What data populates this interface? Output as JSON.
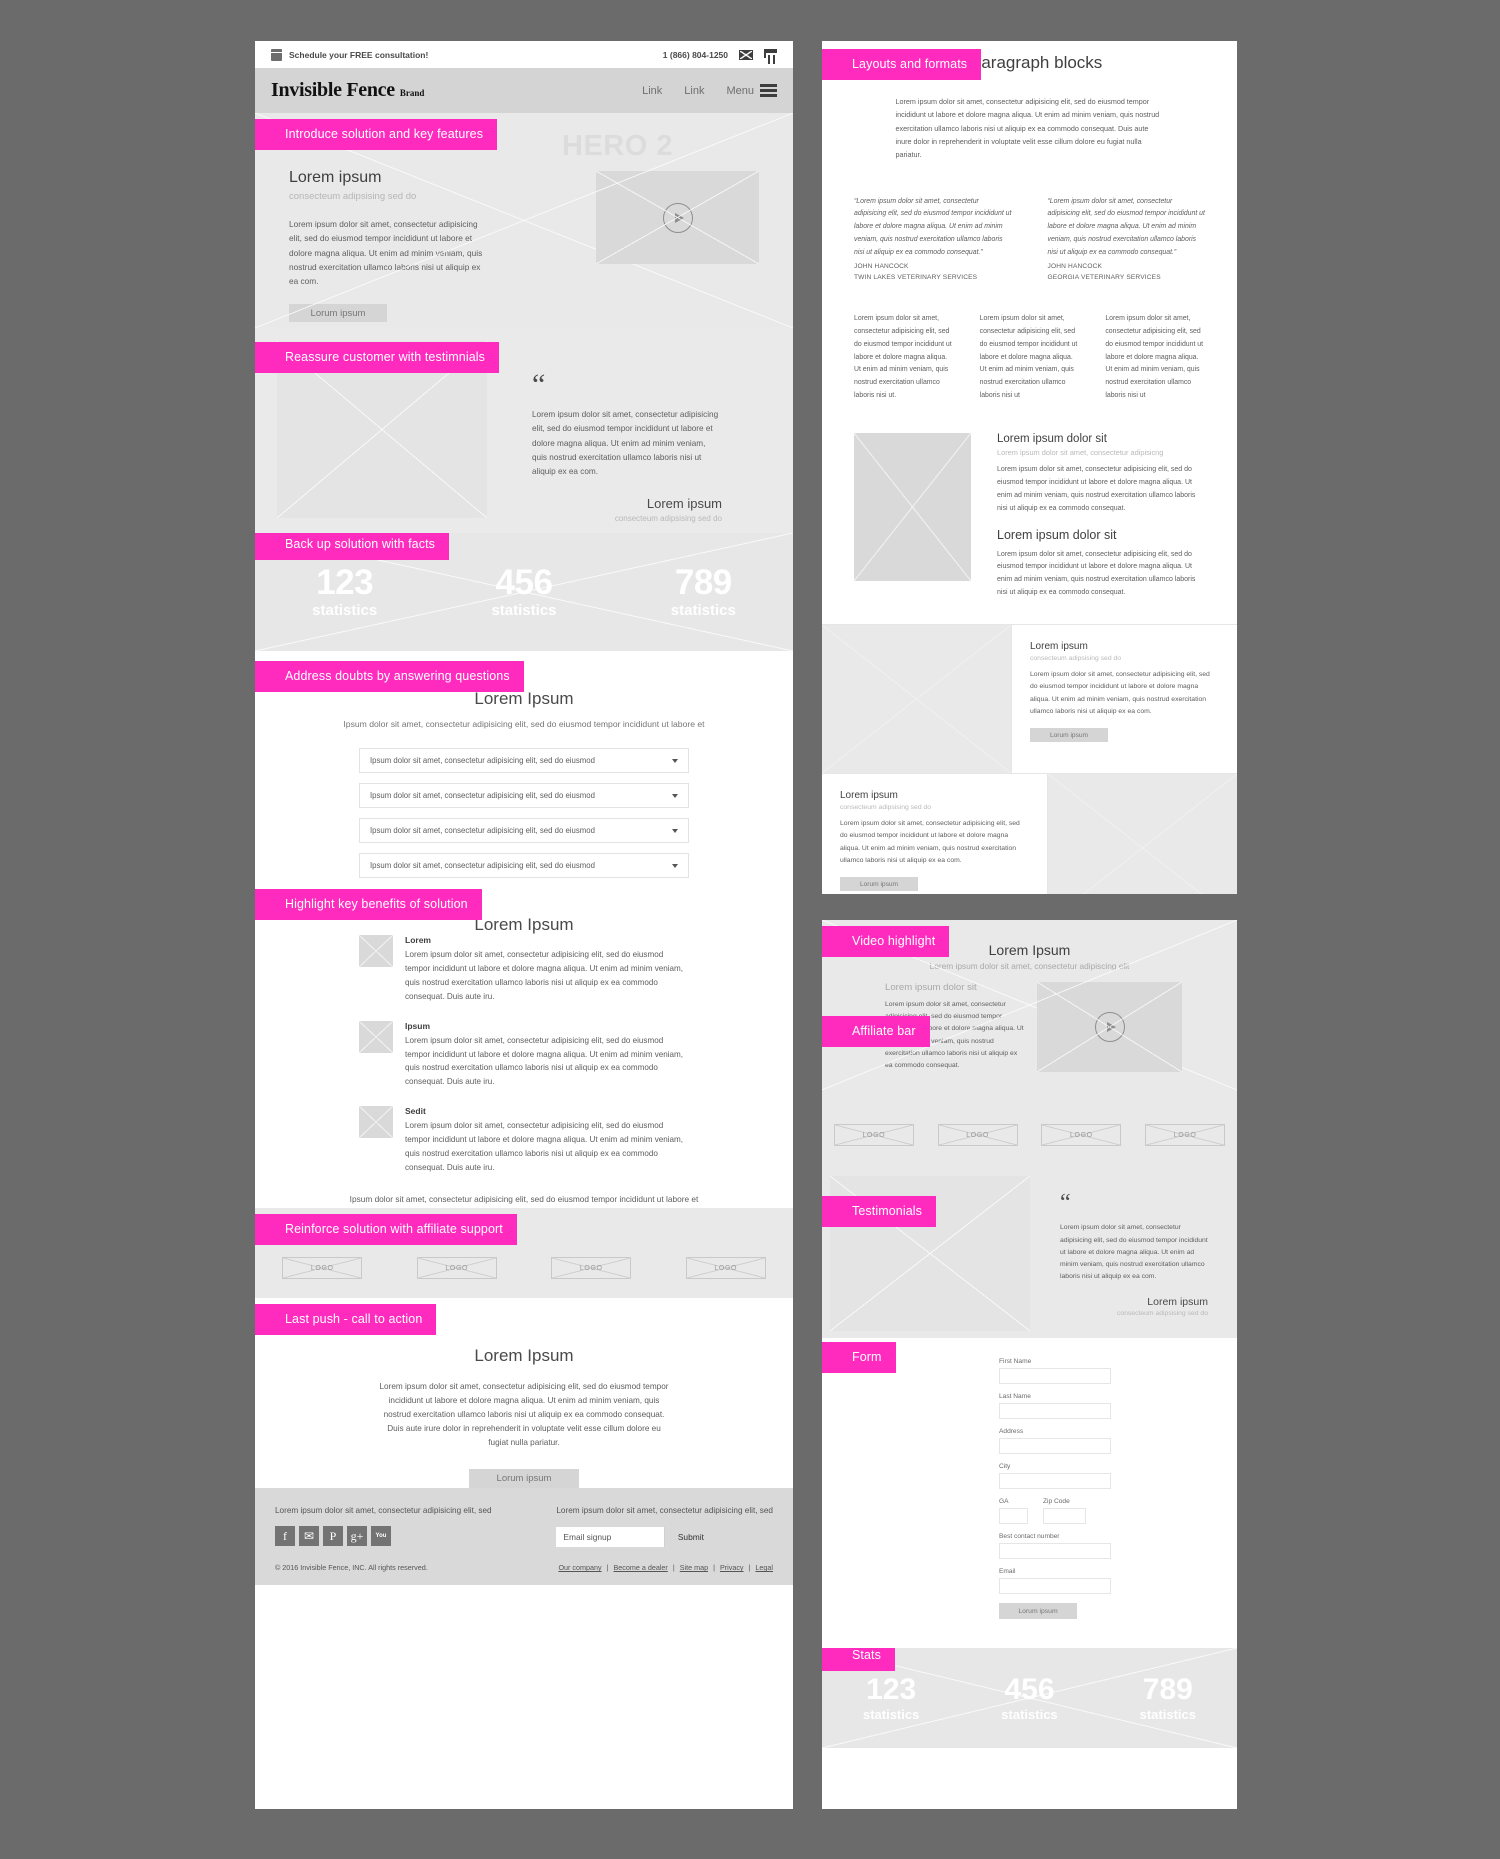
{
  "theme": {
    "accent": "#ff2bbf",
    "page_bg": "#6b6b6b",
    "panel_bg": "#ffffff"
  },
  "panel_a": {
    "utility": {
      "promo": "Schedule your FREE consultation!",
      "phone": "1 (866) 804-1250",
      "calendar_icon": "calendar-icon",
      "mail_icon": "mail-icon",
      "cart_icon": "cart-icon"
    },
    "nav": {
      "logo": "Invisible Fence",
      "logo_suffix": "Brand",
      "link1": "Link",
      "link2": "Link",
      "menu": "Menu",
      "burger_icon": "hamburger-menu-icon"
    },
    "hero": {
      "tag": "Introduce solution and key features",
      "ghost": "HERO 2",
      "title": "Lorem ipsum",
      "subtitle": "consecteum adipsising sed do",
      "body": "Lorem ipsum dolor sit amet, consectetur adipisicing elit, sed do eiusmod tempor incididunt ut labore et dolore magna aliqua. Ut enim ad minim veniam, quis nostrud exercitation ullamco laboris nisi ut aliquip ex ea com.",
      "cta": "Lorum ipsum",
      "play_icon": "play-button-icon"
    },
    "testimonials": {
      "tag": "Reassure customer with testimnials",
      "quote_mark": "“",
      "body": "Lorem ipsum dolor sit amet, consectetur adipisicing elit, sed do eiusmod tempor incididunt ut labore et dolore magna aliqua. Ut enim ad minim veniam, quis nostrud exercitation ullamco laboris nisi ut aliquip ex ea com.",
      "name": "Lorem ipsum",
      "role": "consecteum adipsising sed do"
    },
    "stats": {
      "tag": "Back up solution with facts",
      "items": [
        {
          "number": "123",
          "label": "statistics"
        },
        {
          "number": "456",
          "label": "statistics"
        },
        {
          "number": "789",
          "label": "statistics"
        }
      ]
    },
    "faq": {
      "tag": "Address doubts by answering questions",
      "title": "Lorem Ipsum",
      "subtitle": "Ipsum dolor sit amet, consectetur adipisicing elit, sed do eiusmod tempor incididunt ut labore et",
      "rows": [
        "Ipsum dolor sit amet, consectetur adipisicing elit, sed do eiusmod",
        "Ipsum dolor sit amet, consectetur adipisicing elit, sed do eiusmod",
        "Ipsum dolor sit amet, consectetur adipisicing elit, sed do eiusmod",
        "Ipsum dolor sit amet, consectetur adipisicing elit, sed do eiusmod"
      ],
      "caret_icon": "chevron-down-icon"
    },
    "benefits": {
      "tag": "Highlight key benefits of solution",
      "title": "Lorem Ipsum",
      "items": [
        {
          "title": "Lorem",
          "body": "Lorem ipsum dolor sit amet, consectetur adipisicing elit, sed do eiusmod tempor incididunt ut labore et dolore magna aliqua. Ut enim ad minim veniam, quis nostrud exercitation ullamco laboris nisi ut aliquip ex ea commodo consequat. Duis aute iru."
        },
        {
          "title": "Ipsum",
          "body": "Lorem ipsum dolor sit amet, consectetur adipisicing elit, sed do eiusmod tempor incididunt ut labore et dolore magna aliqua. Ut enim ad minim veniam, quis nostrud exercitation ullamco laboris nisi ut aliquip ex ea commodo consequat. Duis aute iru."
        },
        {
          "title": "Sedit",
          "body": "Lorem ipsum dolor sit amet, consectetur adipisicing elit, sed do eiusmod tempor incididunt ut labore et dolore magna aliqua. Ut enim ad minim veniam, quis nostrud exercitation ullamco laboris nisi ut aliquip ex ea commodo consequat. Duis aute iru."
        }
      ],
      "footer": "Ipsum dolor sit amet, consectetur adipisicing elit, sed do eiusmod tempor incididunt ut labore et"
    },
    "affiliates": {
      "tag": "Reinforce solution with affiliate support",
      "logos": [
        "LOGO",
        "LOGO",
        "LOGO",
        "LOGO"
      ]
    },
    "cta": {
      "tag": "Last push - call to action",
      "title": "Lorem Ipsum",
      "body": "Lorem ipsum dolor sit amet, consectetur adipisicing elit, sed do eiusmod tempor incididunt ut labore et dolore magna aliqua. Ut enim ad minim veniam, quis nostrud exercitation ullamco laboris nisi ut aliquip ex ea commodo consequat. Duis aute irure dolor in reprehenderit in voluptate velit esse cillum dolore eu fugiat nulla pariatur.",
      "button": "Lorum ipsum"
    },
    "footer": {
      "left_text": "Lorem ipsum dolor sit amet, consectetur adipisicing elit, sed",
      "right_text": "Lorem ipsum dolor sit amet, consectetur adipisicing elit, sed",
      "socials": [
        {
          "name": "facebook-icon",
          "glyph": "f"
        },
        {
          "name": "twitter-icon",
          "glyph": "✉"
        },
        {
          "name": "pinterest-icon",
          "glyph": "P"
        },
        {
          "name": "googleplus-icon",
          "glyph": "g+"
        },
        {
          "name": "youtube-icon",
          "glyph": "You"
        }
      ],
      "email_placeholder": "Email signup",
      "submit_label": "Submit",
      "copyright": "© 2016 Invisible Fence, INC. All rights reserved.",
      "links": [
        "Our company",
        "Become a dealer",
        "Site map",
        "Privacy",
        "Legal"
      ]
    }
  },
  "panel_b": {
    "tag": "Layouts and formats",
    "title": "Paragraph blocks",
    "intro": "Lorem ipsum dolor sit amet, consectetur adipisicing elit, sed do eiusmod tempor incididunt ut labore et dolore magna aliqua. Ut enim ad minim veniam, quis nostrud exercitation ullamco laboris nisi ut aliquip ex ea commodo consequat. Duis aute inure dolor in reprehenderit in voluptate velit esse cillum dolore eu fugiat nulla pariatur.",
    "quotes": [
      {
        "text": "“Lorem ipsum dolor sit amet, consectetur adipisicing elit, sed do eiusmod tempor incididunt ut labore et dolore magna aliqua. Ut enim ad minim veniam, quis nostrud exercitation ullamco laboris nisi ut aliquip ex ea commodo consequat.”",
        "author": "JOHN HANCOCK",
        "org": "TWIN LAKES VETERINARY SERVICES"
      },
      {
        "text": "“Lorem ipsum dolor sit amet, consectetur adipisicing elit, sed do eiusmod tempor incididunt ut labore et dolore magna aliqua. Ut enim ad minim veniam, quis nostrud exercitation ullamco laboris nisi ut aliquip ex ea commodo consequat.”",
        "author": "JOHN HANCOCK",
        "org": "GEORGIA VETERINARY SERVICES"
      }
    ],
    "three_col": [
      "Lorem ipsum dolor sit amet, consectetur adipisicing elit, sed do eiusmod tempor incididunt ut labore et dolore magna aliqua. Ut enim ad minim veniam, quis nostrud exercitation ullamco laboris nisi ut.",
      "Lorem ipsum dolor sit amet, consectetur adipisicing elit, sed do eiusmod tempor incididunt ut labore et dolore magna aliqua. Ut enim ad minim veniam, quis nostrud exercitation ullamco laboris nisi ut",
      "Lorem ipsum dolor sit amet, consectetur adipisicing elit, sed do eiusmod tempor incididunt ut labore et dolore magna aliqua. Ut enim ad minim veniam, quis nostrud exercitation ullamco laboris nisi ut"
    ],
    "media": {
      "h1": "Lorem ipsum dolor sit",
      "s1": "Lorem ipsum dolor sit amet, consectetur adipisicng",
      "b1": "Lorem ipsum dolor sit amet, consectetur adipisicing elit, sed do eiusmod tempor incididunt ut labore et dolore magna aliqua. Ut enim ad minim veniam, quis nostrud exercitation ullamco laboris nisi ut aliquip ex ea commodo consequat.",
      "h2": "Lorem ipsum dolor sit",
      "b2": "Lorem ipsum dolor sit amet, consectetur adipisicing elit, sed do eiusmod tempor incididunt ut labore et dolore magna aliqua. Ut enim ad minim veniam, quis nostrud exercitation ullamco laboris nisi ut aliquip ex ea commodo consequat."
    },
    "blocks": [
      {
        "h": "Lorem ipsum",
        "s": "consecteum adipsising sed do",
        "b": "Lorem ipsum dolor sit amet, consectetur adipisicing elit, sed do eiusmod tempor incididunt ut labore et dolore magna aliqua. Ut enim ad minim veniam, quis nostrud exercitation ullamco laboris nisi ut aliquip ex ea com.",
        "btn": "Lorum ipsum"
      },
      {
        "h": "Lorem ipsum",
        "s": "consecteum adipsising sed do",
        "b": "Lorem ipsum dolor sit amet, consectetur adipisicing elit, sed do eiusmod tempor incididunt ut labore et dolore magna aliqua. Ut enim ad minim veniam, quis nostrud exercitation ullamco laboris nisi ut aliquip ex ea com.",
        "btn": "Lorum ipsum"
      }
    ]
  },
  "panel_c": {
    "video": {
      "tag": "Video highlight",
      "title": "Lorem Ipsum",
      "subtitle": "Lorem ipsum dolor sit amet, consectetur adipiscing elit",
      "col_title": "Lorem ipsum dolor sit",
      "col_body": "Lorem ipsum dolor sit amet, consectetur adipisicing elit, sed do eiusmod tempor incididunt ut labore et dolore magna aliqua. Ut enim ad minim veniam, quis nostrud exercitation ullamco laboris nisi ut aliquip ex ea commodo consequat.",
      "play_icon": "play-button-icon"
    },
    "affiliate": {
      "tag": "Affiliate bar",
      "logos": [
        "LOGO",
        "LOGO",
        "LOGO",
        "LOGO"
      ]
    },
    "testimonials": {
      "tag": "Testimonials",
      "quote_mark": "“",
      "body": "Lorem ipsum dolor sit amet, consectetur adipisicing elit, sed do eiusmod tempor incididunt ut labore et dolore magna aliqua. Ut enim ad minim veniam, quis nostrud exercitation ullamco laboris nisi ut aliquip ex ea com.",
      "name": "Lorem ipsum",
      "role": "consecteum adipsising sed do"
    },
    "form": {
      "tag": "Form",
      "fields": [
        {
          "label": "First Name",
          "value": ""
        },
        {
          "label": "Last Name",
          "value": ""
        },
        {
          "label": "Address",
          "value": ""
        },
        {
          "label": "City",
          "value": ""
        }
      ],
      "state_label": "GA",
      "zip_label": "Zip Code",
      "phone_label": "Best contact number",
      "email_label": "Email",
      "submit": "Lorum ipsum"
    },
    "stats": {
      "tag": "Stats",
      "items": [
        {
          "number": "123",
          "label": "statistics"
        },
        {
          "number": "456",
          "label": "statistics"
        },
        {
          "number": "789",
          "label": "statistics"
        }
      ]
    }
  }
}
